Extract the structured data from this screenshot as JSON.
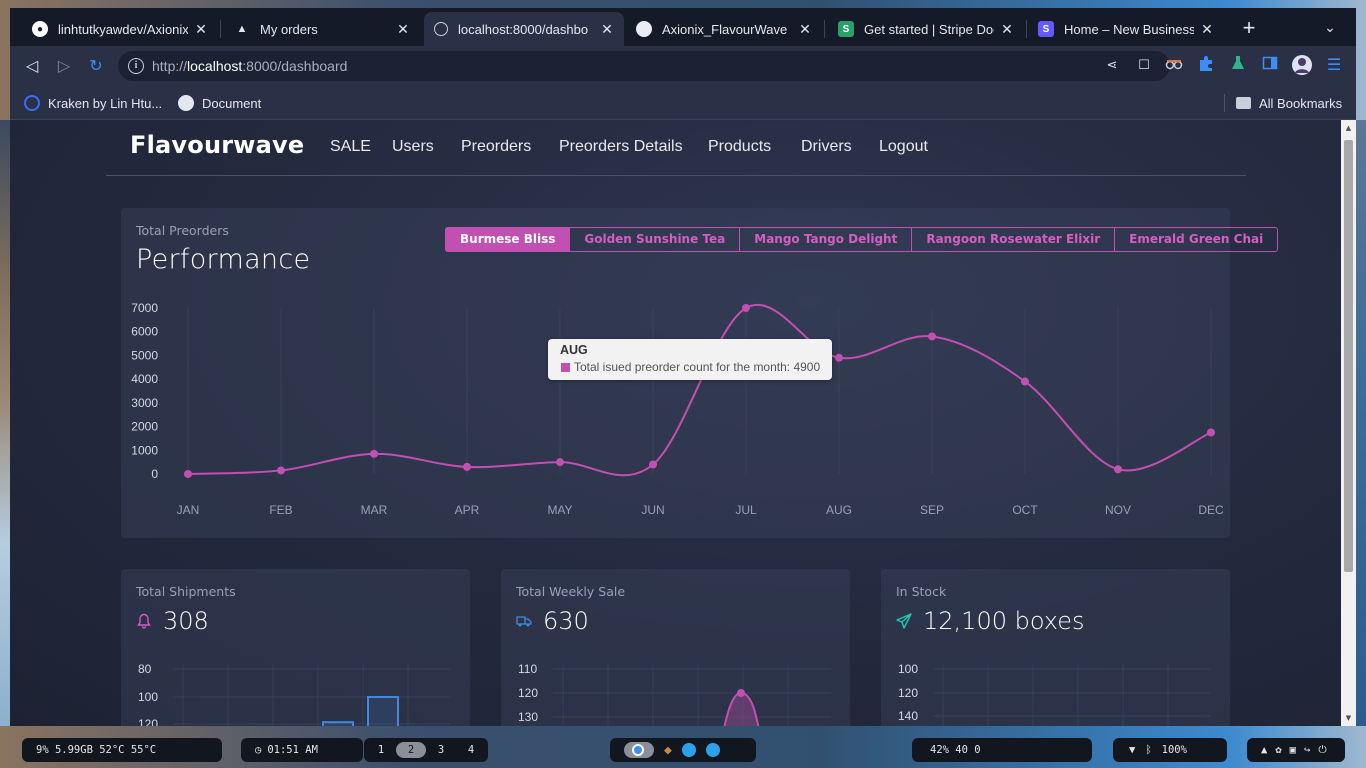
{
  "browser": {
    "tabs": [
      {
        "label": "linhtutkyawdev/Axionix_",
        "favicon": "github-icon"
      },
      {
        "label": "My orders",
        "favicon": "triangle-icon"
      },
      {
        "label": "localhost:8000/dashbo",
        "favicon": "globe-icon",
        "active": true
      },
      {
        "label": "Axionix_FlavourWave |",
        "favicon": "site-icon"
      },
      {
        "label": "Get started | Stripe Doc",
        "favicon": "stripe-icon"
      },
      {
        "label": "Home – New Business",
        "favicon": "stripe-icon"
      }
    ],
    "url_prefix": "http://",
    "url_host": "localhost",
    "url_rest": ":8000/dashboard",
    "bookmarks": [
      {
        "label": "Kraken by Lin Htu..."
      },
      {
        "label": "Document"
      }
    ],
    "all_bookmarks": "All Bookmarks"
  },
  "site": {
    "brand": "Flavourwave",
    "nav": [
      "SALE",
      "Users",
      "Preorders",
      "Preorders Details",
      "Products",
      "Drivers",
      "Logout"
    ]
  },
  "performance": {
    "subtitle": "Total Preorders",
    "title": "Performance",
    "products": [
      "Burmese Bliss",
      "Golden Sunshine Tea",
      "Mango Tango Delight",
      "Rangoon Rosewater Elixir",
      "Emerald Green Chai"
    ],
    "active_product": 0,
    "tooltip": {
      "title": "AUG",
      "text": "Total isued preorder count for the month: 4900"
    }
  },
  "stats": [
    {
      "subtitle": "Total Shipments",
      "value": "308",
      "icon": "bell-icon",
      "color": "#d45ec2"
    },
    {
      "subtitle": "Total Weekly Sale",
      "value": "630",
      "icon": "truck-icon",
      "color": "#3f8ae0"
    },
    {
      "subtitle": "In Stock",
      "value": "12,100 boxes",
      "icon": "paper-plane-icon",
      "color": "#1ec8b0"
    }
  ],
  "chart_data": [
    {
      "type": "line",
      "title": "Performance",
      "categories": [
        "JAN",
        "FEB",
        "MAR",
        "APR",
        "MAY",
        "JUN",
        "JUL",
        "AUG",
        "SEP",
        "OCT",
        "NOV",
        "DEC"
      ],
      "series": [
        {
          "values": [
            0,
            150,
            850,
            300,
            500,
            400,
            7000,
            4900,
            5800,
            3900,
            200,
            1750
          ],
          "color": "#c24fb2"
        }
      ],
      "yticks": [
        0,
        1000,
        2000,
        3000,
        4000,
        5000,
        6000,
        7000
      ],
      "ylim": [
        0,
        7000
      ],
      "grid": "vertical"
    },
    {
      "type": "bar",
      "title": "Total Shipments",
      "yticks": [
        80,
        100,
        120
      ],
      "visible_values": [
        80,
        100
      ],
      "color": "#3f8ae0"
    },
    {
      "type": "area",
      "title": "Total Weekly Sale",
      "yticks": [
        110,
        120,
        130
      ],
      "visible_peak": 120,
      "color": "#c24fb2"
    },
    {
      "type": "scatter",
      "title": "In Stock",
      "yticks": [
        100,
        120,
        140
      ],
      "color": "#1ec8b0"
    }
  ],
  "taskbar": {
    "system": "9%  5.99GB  52°C  55°C",
    "clock": "01:51 AM",
    "workspaces": [
      "1",
      "2",
      "3",
      "4"
    ],
    "active_workspace": 1,
    "volume_status": "42%   40   0",
    "battery": "100%"
  }
}
